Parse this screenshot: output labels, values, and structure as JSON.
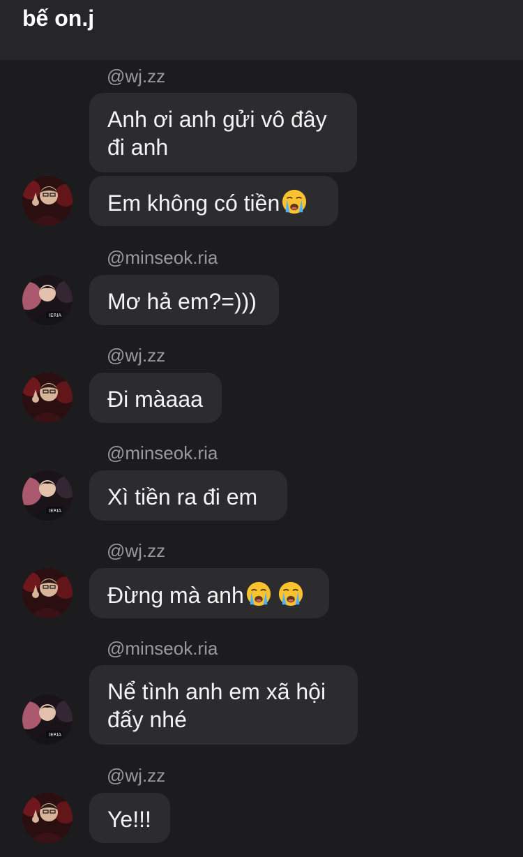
{
  "header": {
    "title": "bế on.j"
  },
  "messages": {
    "m1_user": "@wj.zz",
    "m1_line1": "Anh ơi anh gửi vô đây",
    "m1_line2": "đi anh",
    "m2_text": "Em không có tiền",
    "m3_user": "@minseok.ria",
    "m3_text": "Mơ hả em?=)))",
    "m4_user": "@wj.zz",
    "m4_text": "Đi màaaa",
    "m5_user": "@minseok.ria",
    "m5_text": "Xì tiền ra đi em",
    "m6_user": "@wj.zz",
    "m6_text": "Đừng mà anh",
    "m7_user": "@minseok.ria",
    "m7_line1": "Nể tình anh em xã hội",
    "m7_line2": "đấy nhé",
    "m8_user": "@wj.zz",
    "m8_text": "Ye!!!"
  },
  "icons": {
    "crying_emoji": "loudly-crying-face-icon",
    "avatar_wj": "avatar-wj-zz",
    "avatar_minseok": "avatar-minseok-ria"
  },
  "colors": {
    "background": "#1c1c1e",
    "header": "#262628",
    "bubble": "#2c2c2e",
    "username": "#9a9a9e"
  }
}
